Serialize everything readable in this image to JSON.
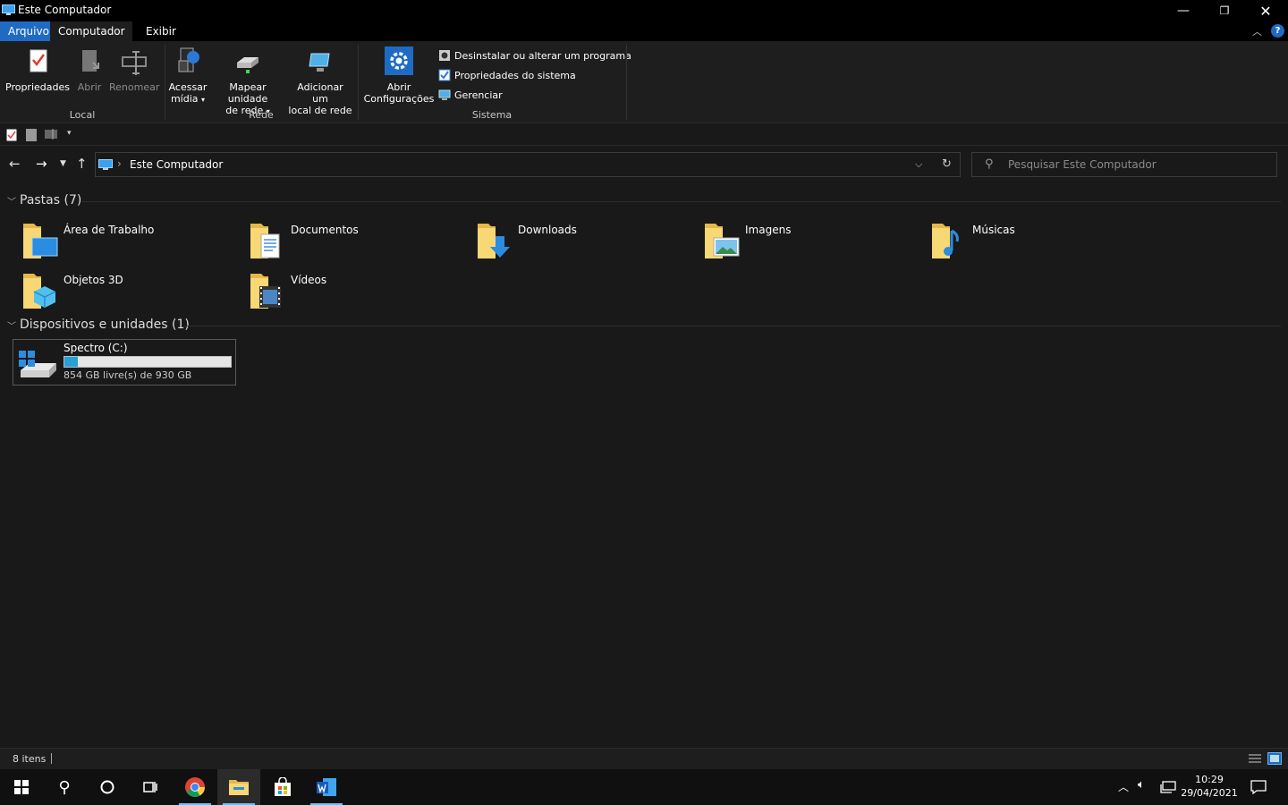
{
  "window": {
    "title": "Este Computador"
  },
  "tabs": {
    "file": "Arquivo",
    "computer": "Computador",
    "view": "Exibir"
  },
  "ribbon": {
    "local": {
      "properties": "Propriedades",
      "open": "Abrir",
      "rename": "Renomear",
      "group": "Local"
    },
    "network": {
      "access_media_1": "Acessar",
      "access_media_2": "mídia",
      "map_drive_1": "Mapear unidade",
      "map_drive_2": "de rede",
      "add_location_1": "Adicionar um",
      "add_location_2": "local de rede",
      "group": "Rede"
    },
    "system": {
      "open_settings_1": "Abrir",
      "open_settings_2": "Configurações",
      "uninstall": "Desinstalar ou alterar um programa",
      "sys_props": "Propriedades do sistema",
      "manage": "Gerenciar",
      "group": "Sistema"
    }
  },
  "address": {
    "path": "Este Computador",
    "search_placeholder": "Pesquisar Este Computador"
  },
  "folders_section": {
    "title": "Pastas (7)"
  },
  "folders": [
    {
      "name": "Área de Trabalho",
      "overlay": "desktop"
    },
    {
      "name": "Documentos",
      "overlay": "document"
    },
    {
      "name": "Downloads",
      "overlay": "download-arrow"
    },
    {
      "name": "Imagens",
      "overlay": "picture"
    },
    {
      "name": "Músicas",
      "overlay": "music-note"
    },
    {
      "name": "Objetos 3D",
      "overlay": "cube"
    },
    {
      "name": "Vídeos",
      "overlay": "film"
    }
  ],
  "devices_section": {
    "title": "Dispositivos e unidades (1)"
  },
  "drive": {
    "name": "Spectro (C:)",
    "free_text": "854 GB livre(s) de 930 GB",
    "used_fraction": 0.082
  },
  "status": {
    "item_count": "8 itens"
  },
  "taskbar": {
    "time": "10:29",
    "date": "29/04/2021"
  },
  "colors": {
    "accent": "#1f6bc4",
    "folder": "#f8d775",
    "drive_fill": "#26a0da"
  }
}
